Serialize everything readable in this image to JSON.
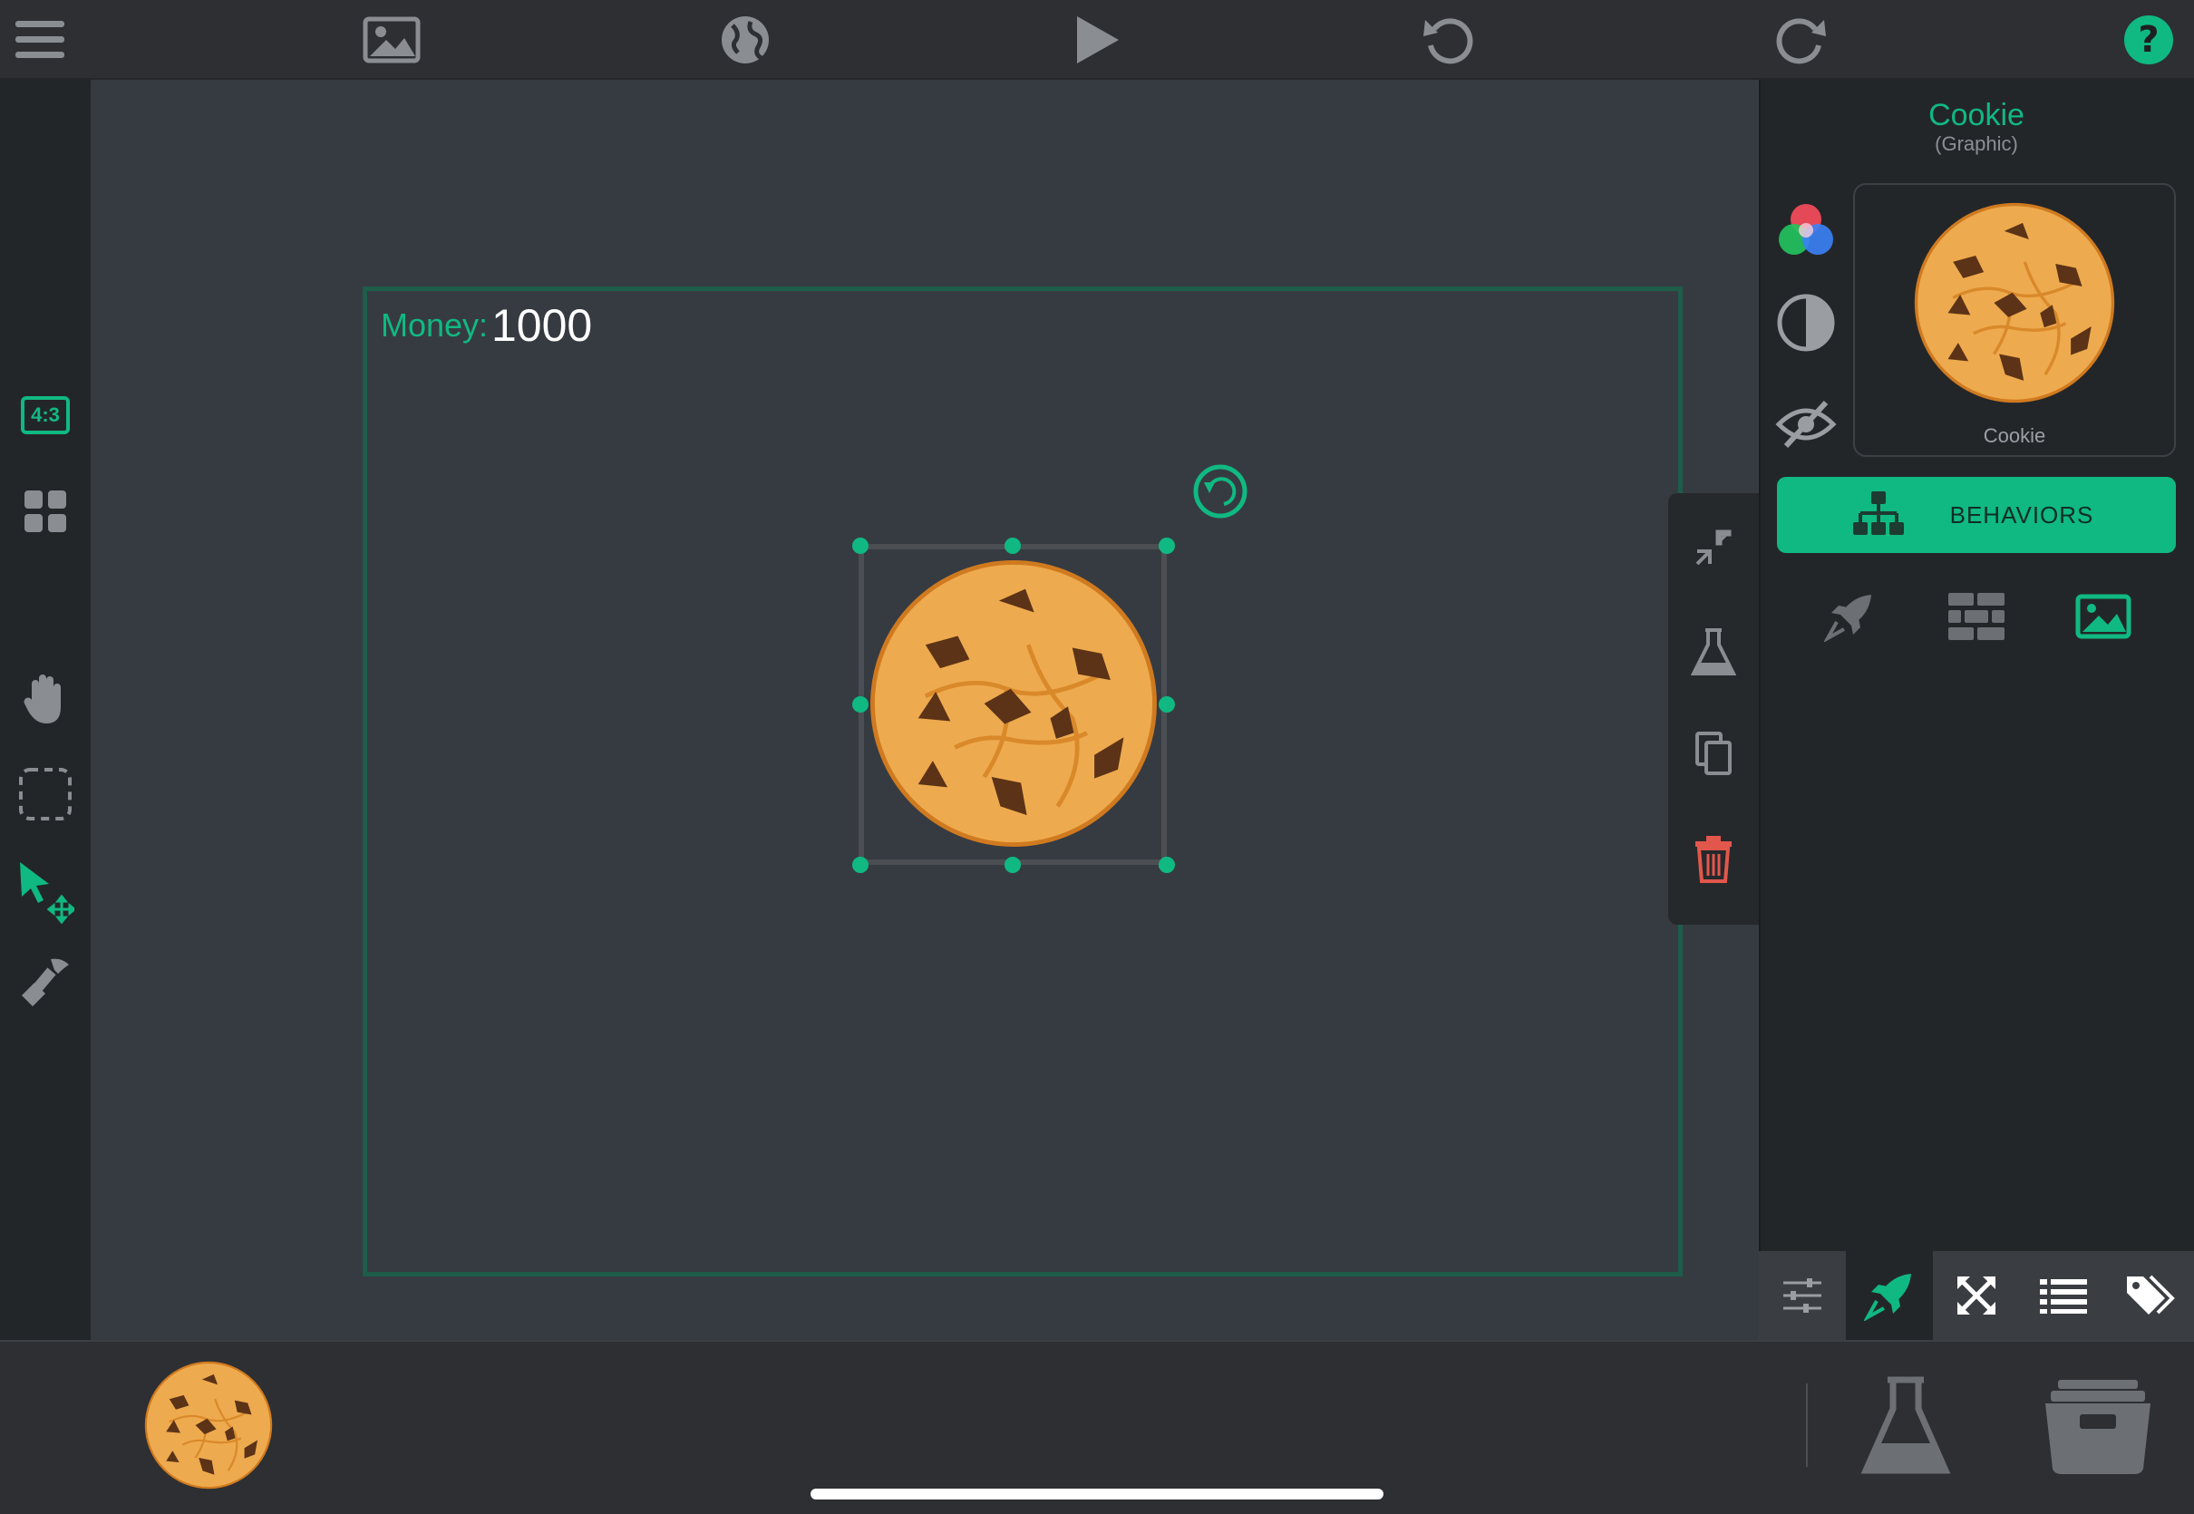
{
  "toolbar": {
    "menu_icon": "hamburger-menu-icon",
    "scene_icon": "image-icon",
    "globe_icon": "globe-icon",
    "play_icon": "play-icon",
    "undo_icon": "undo-icon",
    "redo_icon": "redo-icon",
    "help_icon": "help-icon",
    "help_label": "?"
  },
  "left_tools": {
    "aspect_label": "4:3",
    "items": [
      "grid-icon",
      "hand-icon",
      "marquee-select-icon",
      "pointer-move-icon",
      "stamp-icon"
    ]
  },
  "stage": {
    "money_label": "Money:",
    "money_value": "1000"
  },
  "object_tools": [
    "shrink-icon",
    "flask-icon",
    "duplicate-icon",
    "trash-icon"
  ],
  "panel": {
    "title": "Cookie",
    "subtitle": "(Graphic)",
    "preview_caption": "Cookie",
    "behaviors_label": "BEHAVIORS",
    "side_icons": [
      "color-circles-icon",
      "contrast-icon",
      "eye-hidden-icon"
    ],
    "sub_icons": [
      "rocket-icon",
      "brick-wall-icon",
      "image-icon"
    ]
  },
  "tabs": [
    "sliders-icon",
    "rocket-icon",
    "expand-icon",
    "list-icon",
    "tags-icon"
  ],
  "colors": {
    "accent": "#10b981",
    "danger": "#e2574c",
    "cookie": "#eeaa4e",
    "chip": "#5c3317"
  }
}
